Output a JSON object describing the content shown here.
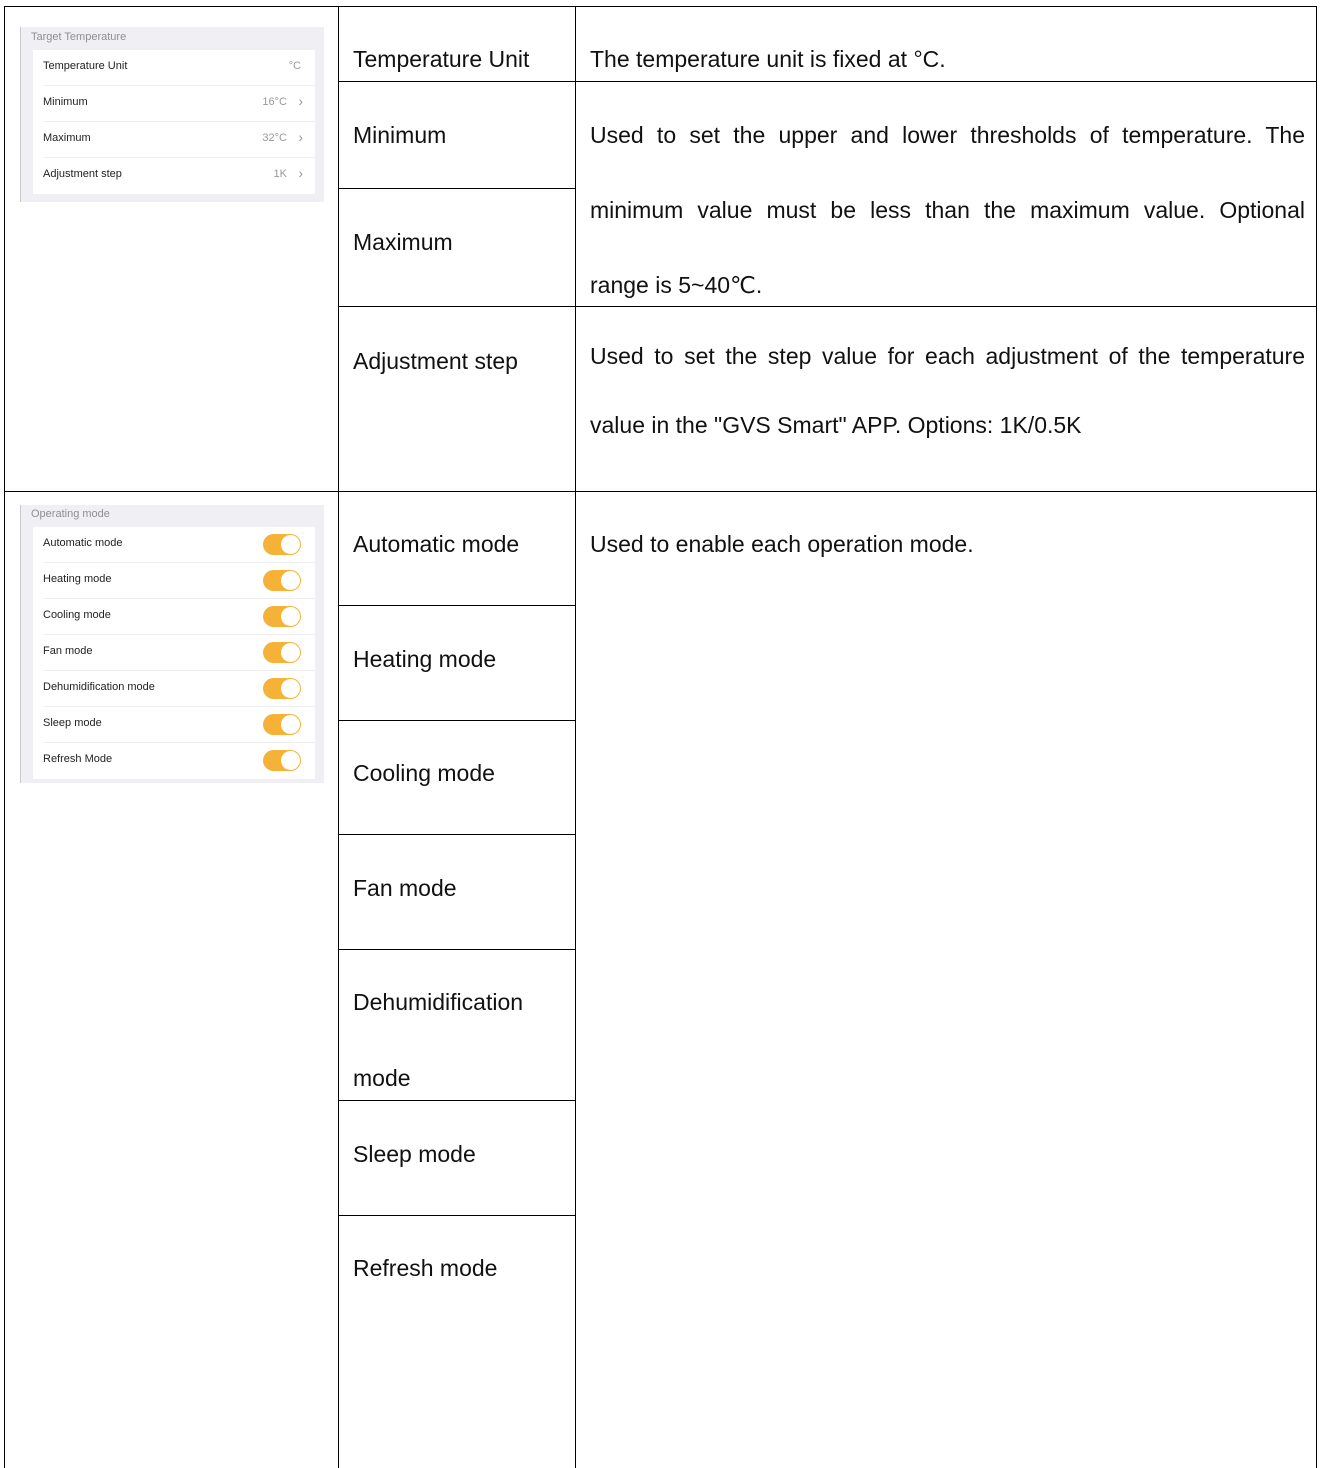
{
  "target_temperature_panel": {
    "title": "Target Temperature",
    "rows": [
      {
        "label": "Temperature Unit",
        "value": "°C"
      },
      {
        "label": "Minimum",
        "value": "16°C"
      },
      {
        "label": "Maximum",
        "value": "32°C"
      },
      {
        "label": "Adjustment step",
        "value": "1K"
      }
    ]
  },
  "operating_mode_panel": {
    "title": "Operating mode",
    "rows": [
      {
        "label": "Automatic mode",
        "enabled": true
      },
      {
        "label": "Heating mode",
        "enabled": true
      },
      {
        "label": "Cooling mode",
        "enabled": true
      },
      {
        "label": "Fan mode",
        "enabled": true
      },
      {
        "label": "Dehumidification mode",
        "enabled": true
      },
      {
        "label": "Sleep mode",
        "enabled": true
      },
      {
        "label": "Refresh Mode",
        "enabled": true
      }
    ]
  },
  "table": {
    "params": {
      "temperature_unit": "Temperature Unit",
      "minimum": "Minimum",
      "maximum": "Maximum",
      "adjustment_step": "Adjustment step",
      "automatic_mode": "Automatic mode",
      "heating_mode": "Heating mode",
      "cooling_mode": "Cooling mode",
      "fan_mode": "Fan mode",
      "dehumidification_line1": "Dehumidification",
      "dehumidification_line2": "mode",
      "sleep_mode": "Sleep mode",
      "refresh_mode": "Refresh mode"
    },
    "descriptions": {
      "temperature_unit": "The temperature unit is fixed at °C.",
      "min_max_line1": "Used to set the upper and lower thresholds of temperature. The",
      "min_max_line2": "minimum value must be less than the maximum value. Optional",
      "min_max_line3": "range is 5~40℃.",
      "step_line1": "Used to set the step value for each adjustment of the temperature",
      "step_line2": "value in the \"GVS Smart\" APP. Options: 1K/0.5K",
      "modes": "Used to enable each operation mode."
    }
  },
  "colors": {
    "toggle_on": "#f5b236",
    "panel_bg": "#f0f0f4",
    "table_border": "#000000"
  }
}
